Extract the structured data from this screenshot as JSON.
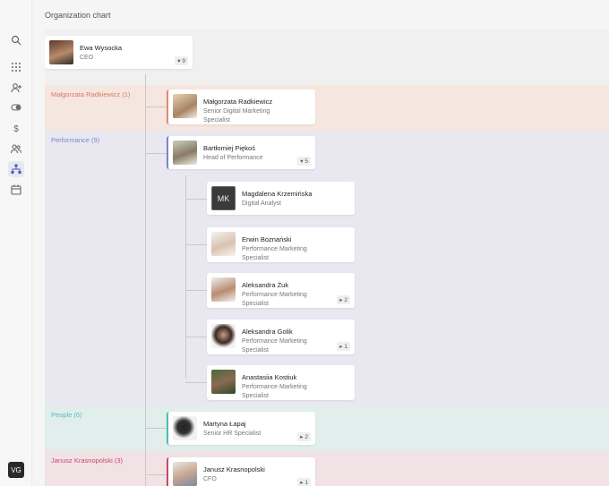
{
  "page": {
    "title": "Organization chart"
  },
  "user": {
    "initials": "VG"
  },
  "nav": [
    {
      "icon": "search-icon"
    },
    {
      "icon": "grid-icon"
    },
    {
      "icon": "user-add-icon"
    },
    {
      "icon": "toggle-icon"
    },
    {
      "icon": "dollar-icon"
    },
    {
      "icon": "people-icon"
    },
    {
      "icon": "org-chart-icon",
      "active": true
    },
    {
      "icon": "calendar-icon"
    }
  ],
  "root": {
    "name": "Ewa Wysocka",
    "title": "CEO",
    "count": "9"
  },
  "groups": [
    {
      "label": "Małgorzata Radkiewicz (1)",
      "color": "#e08a72"
    },
    {
      "label": "Performance (9)",
      "color": "#7b86c9"
    },
    {
      "label": "People (6)",
      "color": "#4fbfb2"
    },
    {
      "label": "Janusz Krasnopolski (3)",
      "color": "#c9476a"
    }
  ],
  "cards": {
    "radkiewicz": {
      "name": "Małgorzata Radkiewicz",
      "title": "Senior Digital Marketing Specialist"
    },
    "piekos": {
      "name": "Bartłomiej Piękoś",
      "title": "Head of Performance",
      "count": "5"
    },
    "krzeminska": {
      "name": "Magdalena Krzemińska",
      "title": "Digital Analyst",
      "initials": "MK"
    },
    "boznanski": {
      "name": "Erwin Boznański",
      "title": "Performance Marketing Specialist"
    },
    "zuk": {
      "name": "Aleksandra Żuk",
      "title": "Performance Marketing Specialist",
      "count": "2"
    },
    "golik": {
      "name": "Aleksandra Golik",
      "title": "Performance Marketing Specialist",
      "count": "1"
    },
    "kostiuk": {
      "name": "Anastasiia Kostiuk",
      "title": "Performance Marketing Specialist"
    },
    "lapaj": {
      "name": "Martyna Łapaj",
      "title": "Senior HR Specialist",
      "count": "2"
    },
    "krasnopolski": {
      "name": "Janusz Krasnopolski",
      "title": "CFO",
      "count": "1"
    }
  }
}
